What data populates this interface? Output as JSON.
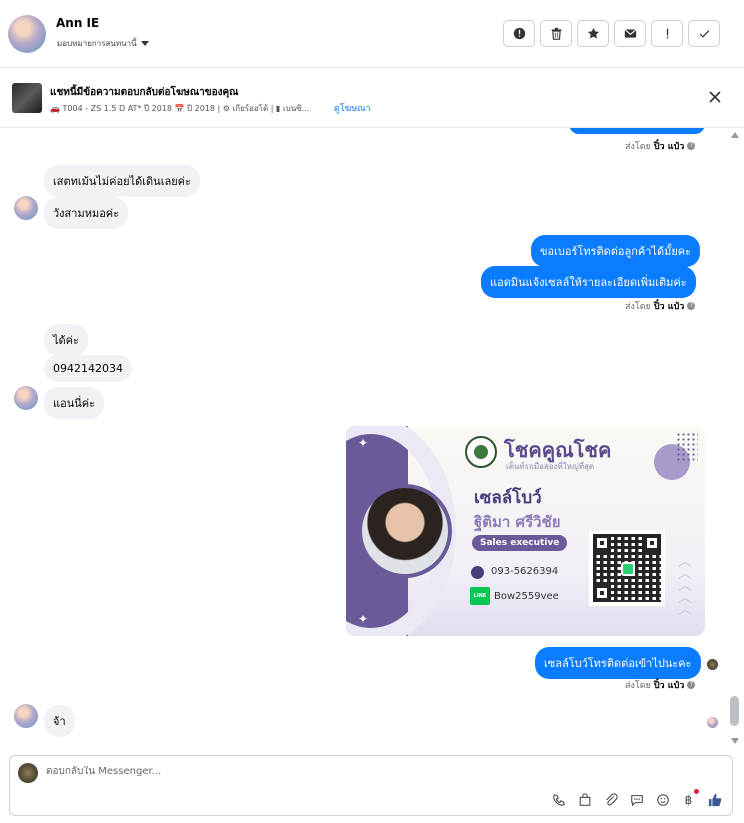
{
  "header": {
    "user_name": "Ann IE",
    "assign_label": "มอบหมายการสนทนานี้",
    "actions": [
      "report",
      "delete",
      "star",
      "mail",
      "important",
      "done"
    ]
  },
  "ad": {
    "title": "แชทนี้มีข้อความตอบกลับต่อโฆษณาของคุณ",
    "subtitle": "🚗 T004 - ZS 1.5 D AT* ปี 2018 📅 ปี 2018 | ⚙ เกียร์ออโต้ | ▮ เบนซิ...",
    "view_ad": "ดูโฆษณา"
  },
  "messages": {
    "sent_by_label": "ส่งโดย",
    "sender_name": "ปิ๋ว แป๋ว",
    "in_1": "เสตทเม้นไม่ค่อยได้เดินเลยค่ะ",
    "in_2": "วังสามหมอค่ะ",
    "out_1": "ขอเบอร์โทรติดต่อลูกค้าได้มั้ยคะ",
    "out_2": "แอดมินแจ้งเซลล์ให้รายละเอียดเพิ่มเติมค่ะ",
    "in_3": "ได้ค่ะ",
    "in_4": "0942142034",
    "in_5": "แอนนี่ค่ะ",
    "out_3": "เซลล์โบว์โทรติดต่อเข้าไปนะคะ",
    "in_6": "จ้า"
  },
  "card": {
    "brand": "โชคคูณโชค",
    "tagline": "เต็นท์รถมือสองที่ใหญ่ที่สุด",
    "nickname": "เซลล์โบว์",
    "full_name": "ฐิติมา ศรีวิชัย",
    "role": "Sales executive",
    "phone": "093-5626394",
    "line_label": "LINE",
    "line_id": "Bow2559vee"
  },
  "composer": {
    "placeholder": "ตอบกลับใน Messenger..."
  },
  "colors": {
    "outgoing": "#0a7cff",
    "incoming": "#f0f2f5",
    "accent": "#1877f2"
  }
}
